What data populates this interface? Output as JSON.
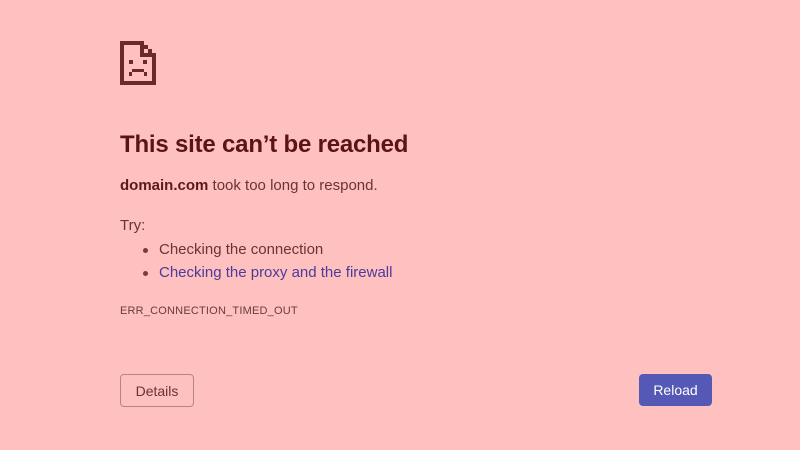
{
  "error_page": {
    "icon": "sad-page-icon",
    "title": "This site can’t be reached",
    "domain": "domain.com",
    "message_suffix": " took too long to respond.",
    "try_label": "Try:",
    "suggestions": [
      {
        "label": "Checking the connection",
        "is_link": false
      },
      {
        "label": "Checking the proxy and the firewall",
        "is_link": true
      }
    ],
    "error_code": "ERR_CONNECTION_TIMED_OUT",
    "details_label": "Details",
    "reload_label": "Reload"
  },
  "colors": {
    "background": "#ffc0c0",
    "title": "#5a1414",
    "text": "#6b3333",
    "link": "#4b3b9a",
    "reload_button": "#5559b5"
  }
}
